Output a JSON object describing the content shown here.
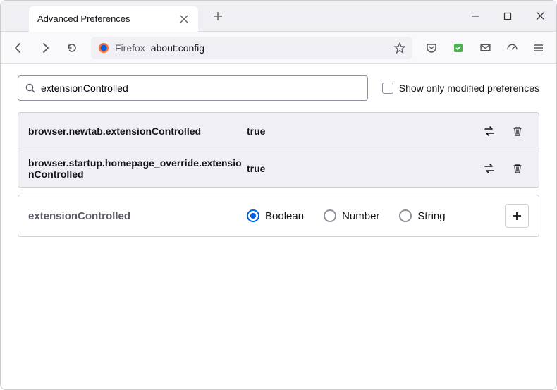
{
  "window": {
    "tab_title": "Advanced Preferences"
  },
  "urlbar": {
    "identity": "Firefox",
    "url": "about:config"
  },
  "search": {
    "value": "extensionControlled",
    "checkbox_label": "Show only modified preferences"
  },
  "prefs": [
    {
      "name": "browser.newtab.extensionControlled",
      "value": "true"
    },
    {
      "name": "browser.startup.homepage_override.extensionControlled",
      "value": "true"
    }
  ],
  "new_pref": {
    "name": "extensionControlled",
    "options": [
      "Boolean",
      "Number",
      "String"
    ],
    "selected": 0
  }
}
